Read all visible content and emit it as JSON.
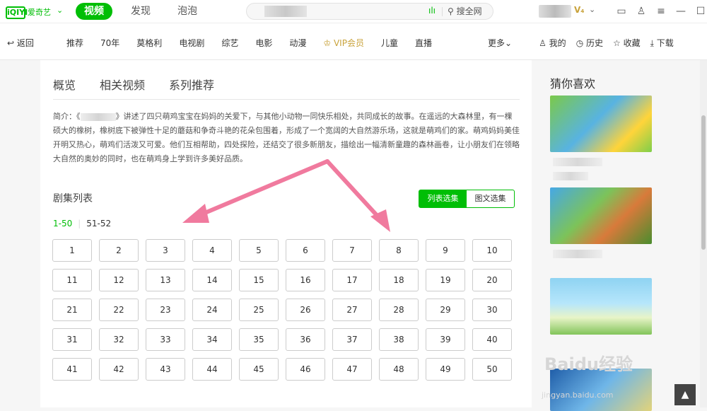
{
  "topbar": {
    "logo_text": "iQIYI",
    "brand_text": "爱奇艺",
    "tabs": [
      "视频",
      "发现",
      "泡泡"
    ],
    "search_hot": "ılı",
    "search_button": "搜全网"
  },
  "nav": {
    "back": "返回",
    "items": [
      "推荐",
      "70年",
      "莫格利",
      "电视剧",
      "综艺",
      "电影",
      "动漫",
      "VIP会员",
      "儿童",
      "直播"
    ],
    "more": "更多",
    "right": [
      "我的",
      "历史",
      "收藏",
      "下载"
    ]
  },
  "content": {
    "tabs": [
      "概览",
      "相关视频",
      "系列推荐"
    ],
    "intro_prefix": "简介：《",
    "intro_text": "》讲述了四只萌鸡宝宝在妈妈的关爱下，与其他小动物一同快乐相处，共同成长的故事。在遥远的大森林里，有一棵硕大的橡树，橡树底下被弹性十足的蘑菇和争奇斗艳的花朵包围着，形成了一个宽阔的大自然游乐场，这就是萌鸡们的家。萌鸡妈妈美佳开明又热心，萌鸡们活泼又可爱。他们互相帮助，四处探险，还结交了很多新朋友，描绘出一幅清新童趣的森林画卷，让小朋友们在领略大自然的奥妙的同时，也在萌鸡身上学到许多美好品质。",
    "episode_title": "剧集列表",
    "toggle": [
      "列表选集",
      "图文选集"
    ],
    "ranges": [
      "1-50",
      "51-52"
    ],
    "episodes": [
      "1",
      "2",
      "3",
      "4",
      "5",
      "6",
      "7",
      "8",
      "9",
      "10",
      "11",
      "12",
      "13",
      "14",
      "15",
      "16",
      "17",
      "18",
      "19",
      "20",
      "21",
      "22",
      "23",
      "24",
      "25",
      "26",
      "27",
      "28",
      "29",
      "30",
      "31",
      "32",
      "33",
      "34",
      "35",
      "36",
      "37",
      "38",
      "39",
      "40",
      "41",
      "42",
      "43",
      "44",
      "45",
      "46",
      "47",
      "48",
      "49",
      "50"
    ]
  },
  "sidebar": {
    "title": "猜你喜欢"
  },
  "watermark": {
    "main": "Baidu经验",
    "sub": "jingyan.baidu.com"
  },
  "colors": {
    "accent": "#00be06",
    "vip": "#c9a33c",
    "arrow": "#f07a9e"
  }
}
